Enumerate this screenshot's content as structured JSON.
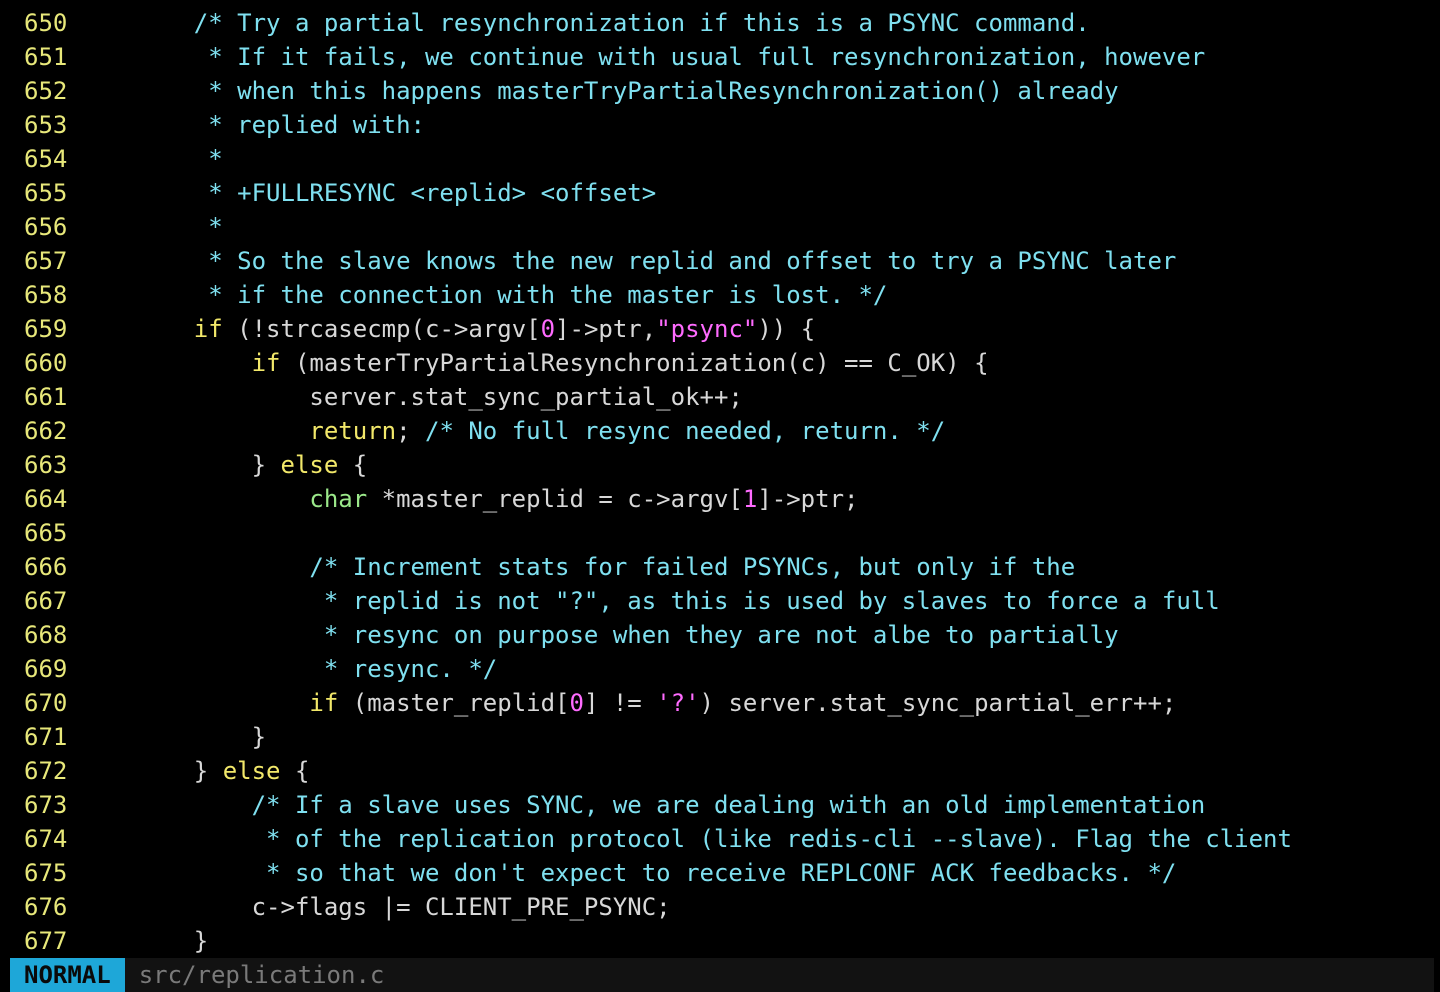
{
  "editor": {
    "lines": [
      {
        "n": "650",
        "segs": [
          [
            "c",
            "    /* Try a partial resynchronization if this is a PSYNC command."
          ]
        ]
      },
      {
        "n": "651",
        "segs": [
          [
            "c",
            "     * If it fails, we continue with usual full resynchronization, however"
          ]
        ]
      },
      {
        "n": "652",
        "segs": [
          [
            "c",
            "     * when this happens masterTryPartialResynchronization() already"
          ]
        ]
      },
      {
        "n": "653",
        "segs": [
          [
            "c",
            "     * replied with:"
          ]
        ]
      },
      {
        "n": "654",
        "segs": [
          [
            "c",
            "     *"
          ]
        ]
      },
      {
        "n": "655",
        "segs": [
          [
            "c",
            "     * +FULLRESYNC <replid> <offset>"
          ]
        ]
      },
      {
        "n": "656",
        "segs": [
          [
            "c",
            "     *"
          ]
        ]
      },
      {
        "n": "657",
        "segs": [
          [
            "c",
            "     * So the slave knows the new replid and offset to try a PSYNC later"
          ]
        ]
      },
      {
        "n": "658",
        "segs": [
          [
            "c",
            "     * if the connection with the master is lost. */"
          ]
        ]
      },
      {
        "n": "659",
        "segs": [
          [
            "p",
            "    "
          ],
          [
            "k",
            "if"
          ],
          [
            "p",
            " (!strcasecmp(c->argv["
          ],
          [
            "s",
            "0"
          ],
          [
            "p",
            "]->ptr,"
          ],
          [
            "s",
            "\"psync\""
          ],
          [
            "p",
            ")) {"
          ]
        ]
      },
      {
        "n": "660",
        "segs": [
          [
            "p",
            "        "
          ],
          [
            "k",
            "if"
          ],
          [
            "p",
            " (masterTryPartialResynchronization(c) == C_OK) {"
          ]
        ]
      },
      {
        "n": "661",
        "segs": [
          [
            "p",
            "            server.stat_sync_partial_ok++;"
          ]
        ]
      },
      {
        "n": "662",
        "segs": [
          [
            "p",
            "            "
          ],
          [
            "k",
            "return"
          ],
          [
            "p",
            "; "
          ],
          [
            "c",
            "/* No full resync needed, return. */"
          ]
        ]
      },
      {
        "n": "663",
        "segs": [
          [
            "p",
            "        } "
          ],
          [
            "k",
            "else"
          ],
          [
            "p",
            " {"
          ]
        ]
      },
      {
        "n": "664",
        "segs": [
          [
            "p",
            "            "
          ],
          [
            "t",
            "char"
          ],
          [
            "p",
            " *master_replid = c->argv["
          ],
          [
            "s",
            "1"
          ],
          [
            "p",
            "]->ptr;"
          ]
        ]
      },
      {
        "n": "665",
        "segs": [
          [
            "p",
            ""
          ]
        ]
      },
      {
        "n": "666",
        "segs": [
          [
            "p",
            "            "
          ],
          [
            "c",
            "/* Increment stats for failed PSYNCs, but only if the"
          ]
        ]
      },
      {
        "n": "667",
        "segs": [
          [
            "c",
            "             * replid is not \"?\", as this is used by slaves to force a full"
          ]
        ]
      },
      {
        "n": "668",
        "segs": [
          [
            "c",
            "             * resync on purpose when they are not albe to partially"
          ]
        ]
      },
      {
        "n": "669",
        "segs": [
          [
            "c",
            "             * resync. */"
          ]
        ]
      },
      {
        "n": "670",
        "segs": [
          [
            "p",
            "            "
          ],
          [
            "k",
            "if"
          ],
          [
            "p",
            " (master_replid["
          ],
          [
            "s",
            "0"
          ],
          [
            "p",
            "] != "
          ],
          [
            "s",
            "'?'"
          ],
          [
            "p",
            ") server.stat_sync_partial_err++;"
          ]
        ]
      },
      {
        "n": "671",
        "segs": [
          [
            "p",
            "        }"
          ]
        ]
      },
      {
        "n": "672",
        "segs": [
          [
            "p",
            "    } "
          ],
          [
            "k",
            "else"
          ],
          [
            "p",
            " {"
          ]
        ]
      },
      {
        "n": "673",
        "segs": [
          [
            "p",
            "        "
          ],
          [
            "c",
            "/* If a slave uses SYNC, we are dealing with an old implementation"
          ]
        ]
      },
      {
        "n": "674",
        "segs": [
          [
            "c",
            "         * of the replication protocol (like redis-cli --slave). Flag the client"
          ]
        ]
      },
      {
        "n": "675",
        "segs": [
          [
            "c",
            "         * so that we don't expect to receive REPLCONF ACK feedbacks. */"
          ]
        ]
      },
      {
        "n": "676",
        "segs": [
          [
            "p",
            "        c->flags |= CLIENT_PRE_PSYNC;"
          ]
        ]
      },
      {
        "n": "677",
        "segs": [
          [
            "p",
            "    }"
          ]
        ]
      }
    ]
  },
  "statusbar": {
    "mode": "NORMAL",
    "file": "src/replication.c"
  },
  "colors": {
    "background": "#000000",
    "line_number": "#e8e87a",
    "comment": "#7fe0f0",
    "keyword": "#f2e86a",
    "type": "#9be88a",
    "literal": "#ff6bff",
    "mode_badge": "#1ea7d8"
  }
}
